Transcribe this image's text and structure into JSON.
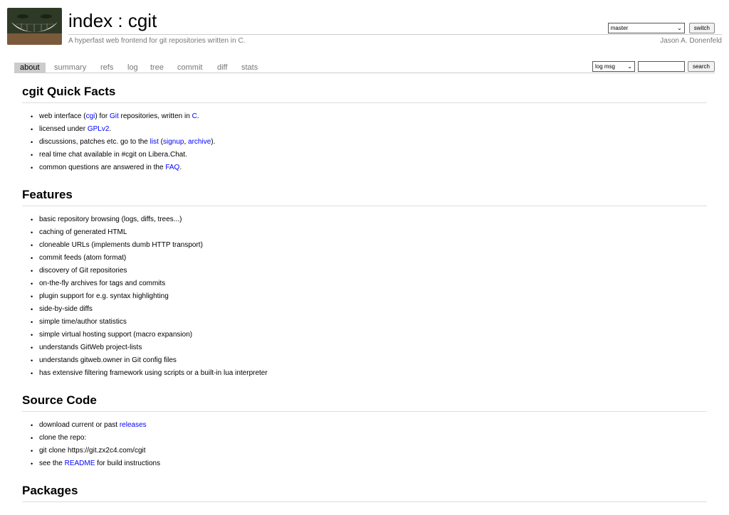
{
  "header": {
    "title": "index : cgit",
    "subtitle": "A hyperfast web frontend for git repositories written in C.",
    "owner": "Jason A. Donenfeld",
    "logo_icon": "grinning-face-logo"
  },
  "branch_form": {
    "selected": "master",
    "switch_label": "switch"
  },
  "tabs": [
    {
      "label": "about",
      "active": true
    },
    {
      "label": "summary"
    },
    {
      "label": "refs"
    },
    {
      "label": "log"
    },
    {
      "label": "tree"
    },
    {
      "label": "commit"
    },
    {
      "label": "diff"
    },
    {
      "label": "stats"
    }
  ],
  "search": {
    "selected": "log msg",
    "value": "",
    "button_label": "search"
  },
  "sections": {
    "facts": {
      "heading": "cgit Quick Facts",
      "items": [
        {
          "parts": [
            "web interface (",
            "cgi",
            ") for ",
            "Git",
            " repositories, written in ",
            "C",
            "."
          ]
        },
        {
          "parts": [
            "licensed under ",
            "GPLv2",
            "."
          ]
        },
        {
          "parts": [
            "discussions, patches etc. go to the ",
            "list",
            " (",
            "signup",
            ", ",
            "archive",
            ")."
          ]
        },
        {
          "text": "real time chat available in #cgit on Libera.Chat."
        },
        {
          "parts": [
            "common questions are answered in the ",
            "FAQ",
            "."
          ]
        }
      ]
    },
    "features": {
      "heading": "Features",
      "items": [
        "basic repository browsing (logs, diffs, trees...)",
        "caching of generated HTML",
        "cloneable URLs (implements dumb HTTP transport)",
        "commit feeds (atom format)",
        "discovery of Git repositories",
        "on-the-fly archives for tags and commits",
        "plugin support for e.g. syntax highlighting",
        "side-by-side diffs",
        "simple time/author statistics",
        "simple virtual hosting support (macro expansion)",
        "understands GitWeb project-lists",
        "understands gitweb.owner in Git config files",
        "has extensive filtering framework using scripts or a built-in lua interpreter"
      ]
    },
    "source": {
      "heading": "Source Code",
      "items": [
        {
          "parts": [
            "download current or past ",
            "releases"
          ]
        },
        {
          "text": "clone the repo:"
        },
        {
          "text": "git clone https://git.zx2c4.com/cgit"
        },
        {
          "parts": [
            "see the ",
            "README",
            " for build instructions"
          ]
        }
      ]
    },
    "packages": {
      "heading": "Packages"
    }
  },
  "colors": {
    "link": "#0000ff",
    "muted": "#777777",
    "tab_active_bg": "#cccccc"
  }
}
